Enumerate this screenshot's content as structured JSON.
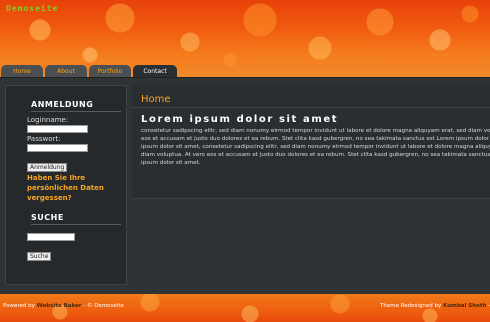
{
  "header": {
    "logo_text": "Demoseite",
    "nav": [
      {
        "label": "Home"
      },
      {
        "label": "About"
      },
      {
        "label": "Portfolio"
      },
      {
        "label": "Contact"
      }
    ]
  },
  "sidebar": {
    "login_heading": "ANMELDUNG",
    "username_label": "Loginname:",
    "password_label": "Passwort:",
    "login_button": "Anmeldung",
    "forgot_link": "Haben Sie Ihre persönlichen Daten vergessen?",
    "search_heading": "SUCHE",
    "search_button": "Suche"
  },
  "main": {
    "page_title": "Home",
    "article_heading": "Lorem ipsum dolor sit amet",
    "body_lines": [
      "consetetur sadipscing elitr, sed diam nonumy eirmod tempor invidunt ut labore et dolore magna aliquyam erat, sed diam volup",
      "eos et accusam et justo duo dolores et ea rebum. Stet clita kasd gubergren, no sea takimata sanctus est Lorem ipsum dolor sit",
      "ipsum dolor sit amet, consetetur sadipscing elitr, sed diam nonumy eirmod tempor invidunt ut labore et dolore magna aliquyam",
      "diam voluptua. At vero eos et accusam et justo duo dolores et ea rebum. Stet clita kasd gubergren, no sea takimata sanctus",
      "ipsum dolor sit amet."
    ]
  },
  "footer": {
    "powered_prefix": "Powered by",
    "powered_link": "Website Baker",
    "powered_suffix": "- © Demoseite",
    "theme_prefix": "Theme Redesigned by",
    "theme_link": "Kumbal Sheth",
    "theme_suffix": "- "
  },
  "colors": {
    "accent_orange": "#f5a623",
    "header_orange": "#f05a10",
    "logo_green": "#7ad02a",
    "background": "#2e3336"
  }
}
